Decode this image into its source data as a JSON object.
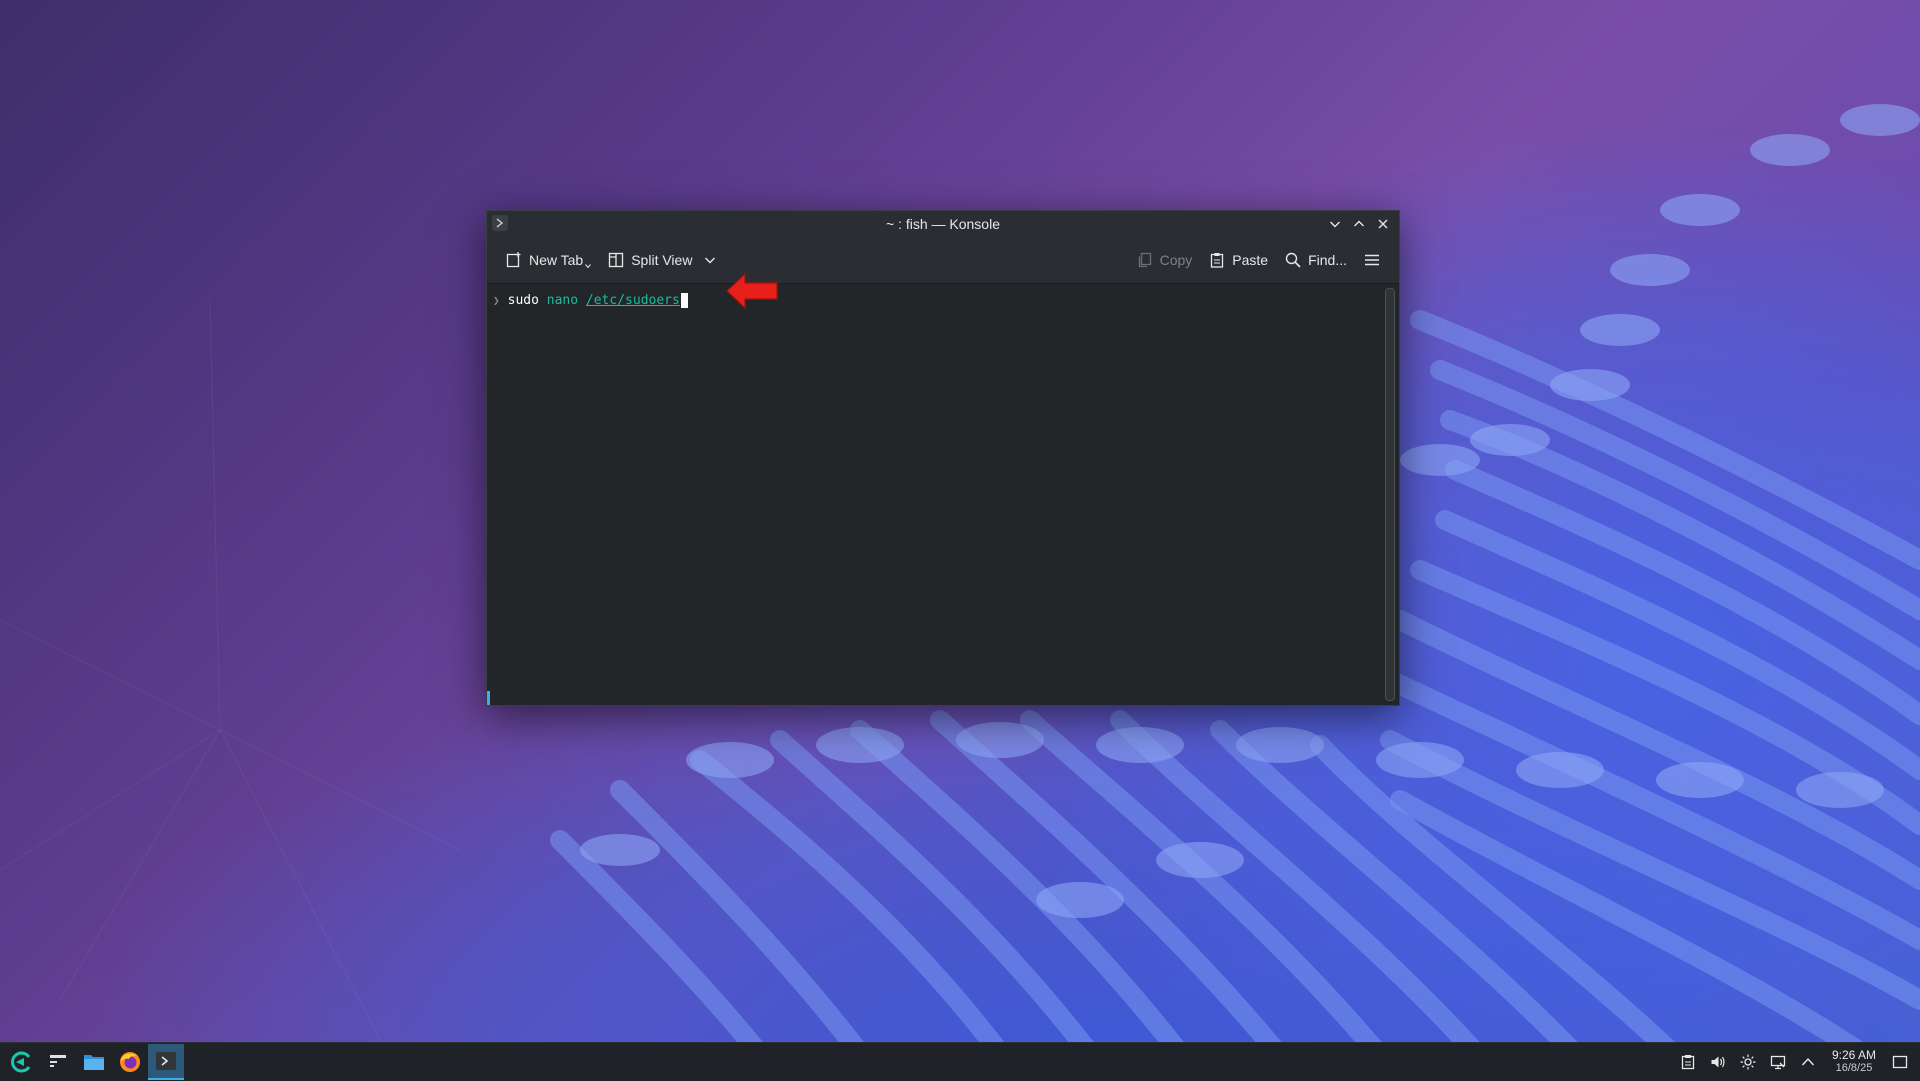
{
  "window": {
    "title": "~ : fish — Konsole"
  },
  "toolbar": {
    "new_tab_label": "New Tab",
    "split_view_label": "Split View",
    "copy_label": "Copy",
    "paste_label": "Paste",
    "find_label": "Find..."
  },
  "terminal": {
    "prompt": "❯",
    "command": "sudo",
    "argument": "nano",
    "path": "/etc/sudoers"
  },
  "annotation": {
    "arrow_color": "#e8201a",
    "arrow_direction": "left"
  },
  "taskbar": {
    "clock_time": "9:26 AM",
    "clock_date": "16/8/25",
    "tasks": [
      "app-launcher-icon",
      "overview-icon",
      "file-manager-icon",
      "firefox-icon",
      "konsole-icon"
    ],
    "tray": [
      "clipboard-icon",
      "volume-icon",
      "brightness-icon",
      "network-icon",
      "tray-expand-icon",
      "show-desktop-icon"
    ]
  },
  "colors": {
    "accent": "#3daee9",
    "terminal_bg": "#232629",
    "command_highlight": "#1abc9c"
  }
}
